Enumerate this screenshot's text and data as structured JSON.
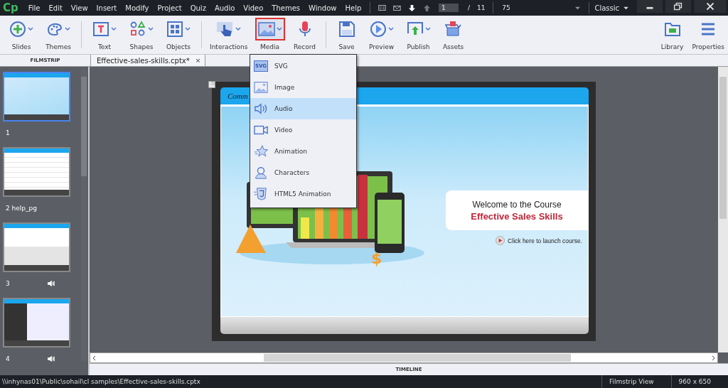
{
  "menu_bar": {
    "logo": "Cp",
    "items": [
      "File",
      "Edit",
      "View",
      "Insert",
      "Modify",
      "Project",
      "Quiz",
      "Audio",
      "Video",
      "Themes",
      "Window",
      "Help"
    ],
    "page": "1",
    "page_sep": "/",
    "page_total": "11",
    "zoom": "75",
    "workspace": "Classic"
  },
  "toolbar": {
    "groups": [
      {
        "buttons": [
          {
            "label": "Slides",
            "has_dropdown": true,
            "selected": false
          },
          {
            "label": "Themes",
            "has_dropdown": true,
            "selected": false
          }
        ]
      },
      {
        "buttons": [
          {
            "label": "Text",
            "has_dropdown": true,
            "selected": false
          },
          {
            "label": "Shapes",
            "has_dropdown": true,
            "selected": false
          },
          {
            "label": "Objects",
            "has_dropdown": true,
            "selected": false
          }
        ]
      },
      {
        "buttons": [
          {
            "label": "Interactions",
            "has_dropdown": true,
            "selected": false
          },
          {
            "label": "Media",
            "has_dropdown": true,
            "selected": true
          },
          {
            "label": "Record",
            "has_dropdown": false,
            "selected": false
          }
        ]
      },
      {
        "buttons": [
          {
            "label": "Save",
            "has_dropdown": false,
            "selected": false
          },
          {
            "label": "Preview",
            "has_dropdown": true,
            "selected": false
          },
          {
            "label": "Publish",
            "has_dropdown": true,
            "selected": false
          },
          {
            "label": "Assets",
            "has_dropdown": false,
            "selected": false
          }
        ]
      }
    ],
    "right": [
      {
        "label": "Library"
      },
      {
        "label": "Properties"
      }
    ]
  },
  "filmstrip": {
    "header": "FILMSTRIP",
    "slides": [
      {
        "label": "1",
        "selected": true,
        "audio": false
      },
      {
        "label": "2 help_pg",
        "selected": false,
        "audio": false
      },
      {
        "label": "3",
        "selected": false,
        "audio": true
      },
      {
        "label": "4",
        "selected": false,
        "audio": true
      }
    ]
  },
  "document_tab": {
    "title": "Effective-sales-skills.cptx*",
    "close": "×"
  },
  "media_menu": {
    "items": [
      {
        "label": "SVG",
        "selected": false,
        "icon_text": "SVG"
      },
      {
        "label": "Image",
        "selected": false
      },
      {
        "label": "Audio",
        "selected": true
      },
      {
        "label": "Video",
        "selected": false
      },
      {
        "label": "Animation",
        "selected": false
      },
      {
        "label": "Characters",
        "selected": false
      },
      {
        "label": "HTML5 Animation",
        "selected": false
      }
    ]
  },
  "slide": {
    "logo": "Comm",
    "currency_sign": "$",
    "welcome": "Welcome to the Course",
    "title": "Effective Sales Skills",
    "launch": "Click here to launch course."
  },
  "timeline": "TIMELINE",
  "status_bar": {
    "path": "\\\\inhynas01\\Public\\sohail\\cl samples\\Effective-sales-skills.cptx",
    "view": "Filmstrip View",
    "size": "960 x 650"
  }
}
